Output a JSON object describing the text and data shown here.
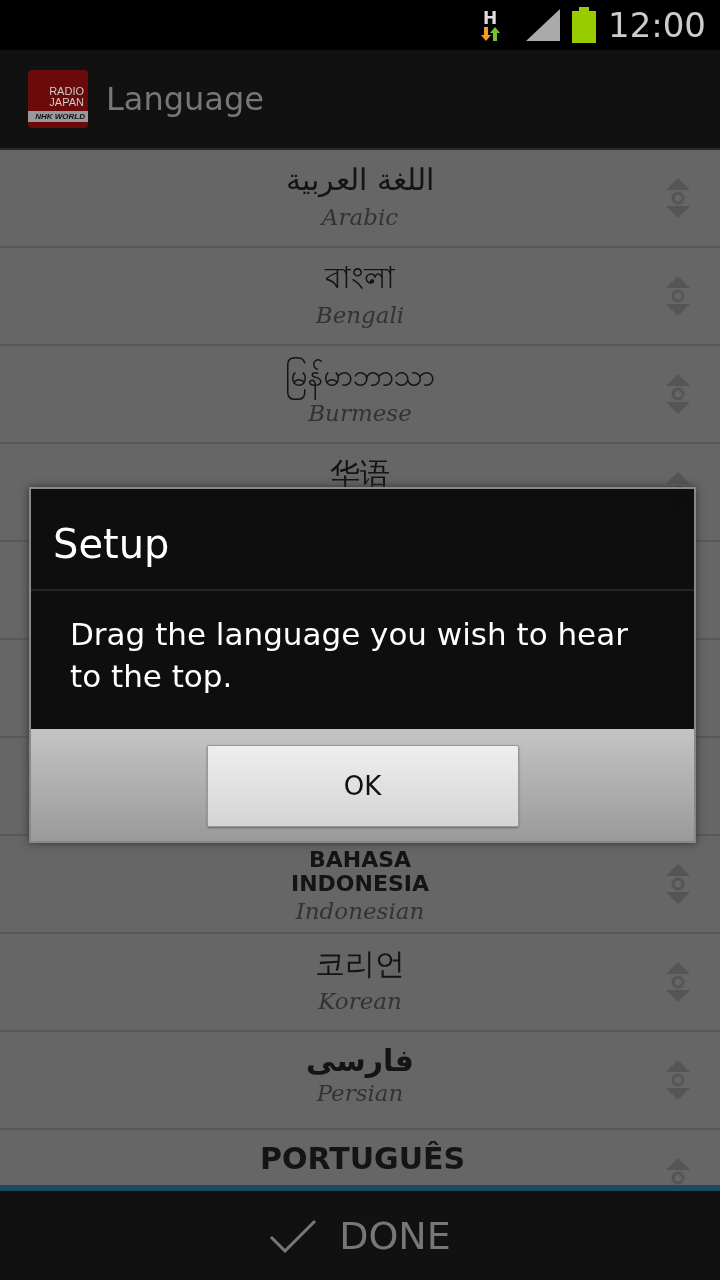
{
  "status_bar": {
    "network_type": "H",
    "time": "12:00"
  },
  "app_bar": {
    "logo_top": "RADIO",
    "logo_middle": "JAPAN",
    "logo_bottom": "NHK WORLD",
    "title": "Language"
  },
  "languages": [
    {
      "kind": "plain",
      "native": "اللغة العربية",
      "english": "Arabic"
    },
    {
      "kind": "plain",
      "native": "বাংলা",
      "english": "Bengali"
    },
    {
      "kind": "plain",
      "native": "မြန်မာဘာသာ",
      "english": "Burmese"
    },
    {
      "kind": "plain",
      "native": "华语"
    },
    {
      "kind": "covered"
    },
    {
      "kind": "covered"
    },
    {
      "kind": "covered"
    },
    {
      "kind": "bold",
      "native": "BAHASA INDONESIA",
      "english": "Indonesian"
    },
    {
      "kind": "plain",
      "native": "코리언",
      "english": "Korean"
    },
    {
      "kind": "bold",
      "native": "فارسی",
      "english": "Persian"
    },
    {
      "kind": "bold",
      "native": "PORTUGUÊS"
    }
  ],
  "dialog": {
    "title": "Setup",
    "message": "Drag the language you wish to hear to the top.",
    "buttons": [
      "OK"
    ]
  },
  "done_button": {
    "label": "DONE"
  }
}
